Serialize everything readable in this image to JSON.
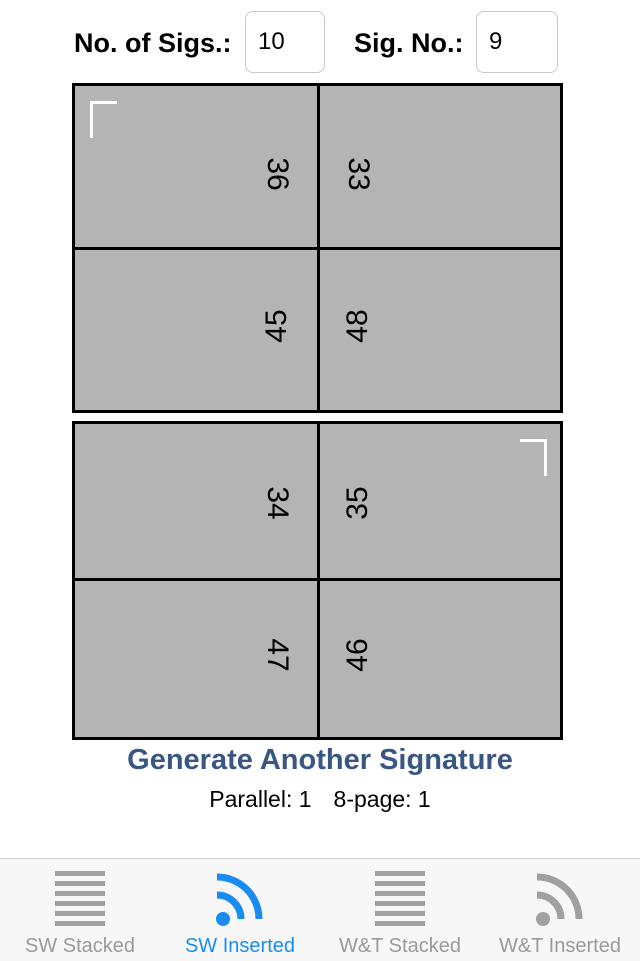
{
  "header": {
    "sigs_label": "No. of Sigs.:",
    "sigs_value": "10",
    "signo_label": "Sig. No.:",
    "signo_value": "9"
  },
  "sheet_top": {
    "pages": [
      "36",
      "33",
      "45",
      "48"
    ]
  },
  "sheet_bottom": {
    "pages": [
      "34",
      "35",
      "47",
      "46"
    ]
  },
  "generate_label": "Generate Another Signature",
  "status": {
    "parallel": "Parallel: 1",
    "eight_page": "8-page: 1"
  },
  "tabs": [
    {
      "label": "SW Stacked",
      "icon": "stacked-lines-icon",
      "active": false
    },
    {
      "label": "SW Inserted",
      "icon": "inserted-arcs-icon",
      "active": true
    },
    {
      "label": "W&T Stacked",
      "icon": "stacked-lines-icon",
      "active": false
    },
    {
      "label": "W&T Inserted",
      "icon": "inserted-arcs-icon",
      "active": false
    }
  ],
  "colors": {
    "accent": "#1a8cf0",
    "inactive": "#9a9a9a",
    "link": "#3a5684",
    "sheet": "#b4b4b4"
  }
}
